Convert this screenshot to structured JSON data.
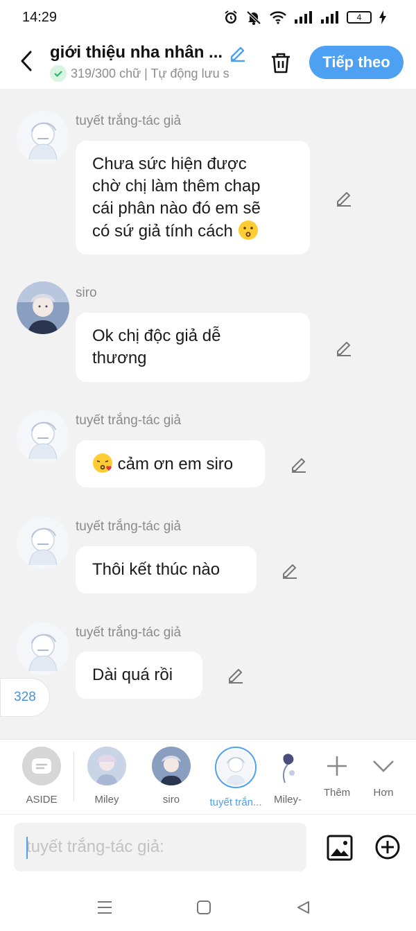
{
  "status_bar": {
    "time": "14:29",
    "battery": "4"
  },
  "header": {
    "title": "giới thiệu nha nhân ...",
    "subtitle": "319/300 chữ | Tự động lưu s",
    "next_label": "Tiếp theo"
  },
  "messages": [
    {
      "sender": "tuyết trắng-tác giả",
      "lines": [
        "Chưa sức hiện được",
        "chờ chị làm thêm chap",
        "cái phân nào đó em sẽ",
        "có sứ giả tính cách"
      ],
      "emoji": "kissing-face-icon"
    },
    {
      "sender": "siro",
      "lines": [
        "Ok chị độc giả dễ",
        "thương"
      ]
    },
    {
      "sender": "tuyết trắng-tác giả",
      "text": "cảm ơn em siro",
      "emoji": "face-blowing-kiss-icon"
    },
    {
      "sender": "tuyết trắng-tác giả",
      "text": "Thôi kết thúc nào"
    },
    {
      "sender": "tuyết trắng-tác giả",
      "text": "Dài quá rồi"
    }
  ],
  "count_badge": "328",
  "characters": {
    "aside": "ASIDE",
    "items": [
      "Miley",
      "siro",
      "tuyết trắn...",
      "Miley-"
    ],
    "add_label": "Thêm",
    "more_label": "Hơn"
  },
  "input": {
    "placeholder": "tuyết trắng-tác giả:"
  },
  "colors": {
    "accent": "#4da0f2",
    "background": "#f2f2f2",
    "bubble": "#ffffff"
  }
}
